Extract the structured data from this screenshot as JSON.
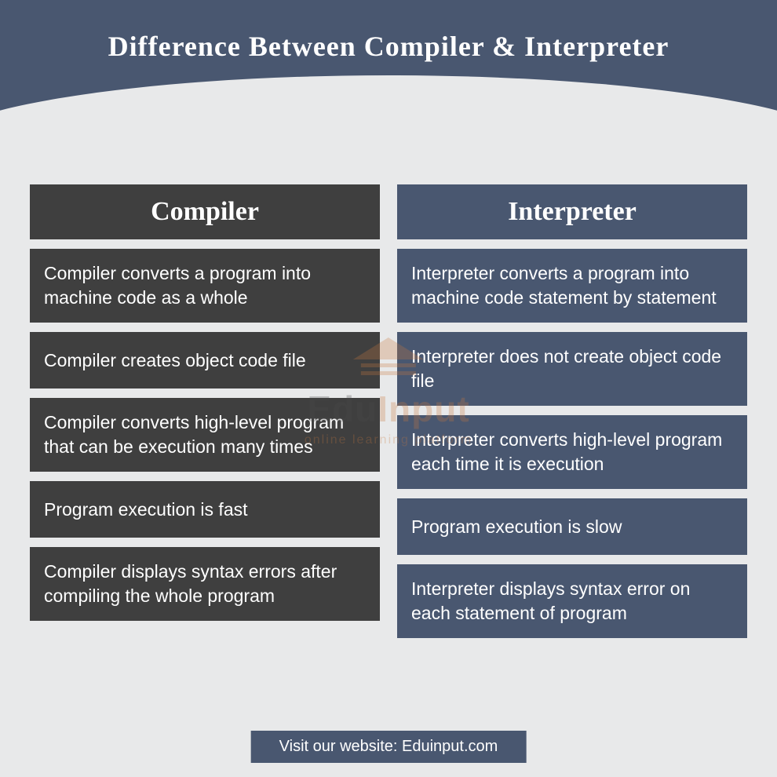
{
  "title": "Difference Between Compiler & Interpreter",
  "columns": {
    "left": {
      "header": "Compiler",
      "rows": [
        "Compiler converts a program into machine code as a whole",
        "Compiler creates object code file",
        "Compiler converts high-level program that can be execution many times",
        "Program execution is fast",
        "Compiler displays syntax errors after compiling the whole program"
      ]
    },
    "right": {
      "header": "Interpreter",
      "rows": [
        "Interpreter converts a program into machine code statement by statement",
        "Interpreter does not create object code file",
        "Interpreter converts high-level program each time it is execution",
        "Program execution is slow",
        "Interpreter displays syntax error on each statement of program"
      ]
    }
  },
  "footer": "Visit our website: Eduinput.com",
  "watermark": {
    "brand_prefix": "Edu",
    "brand_suffix": "Input",
    "tagline": "online learning platform"
  },
  "chart_data": {
    "type": "table",
    "title": "Difference Between Compiler & Interpreter",
    "columns": [
      "Compiler",
      "Interpreter"
    ],
    "rows": [
      [
        "Compiler converts a program into machine code as a whole",
        "Interpreter converts a program into machine code statement by statement"
      ],
      [
        "Compiler creates object code file",
        "Interpreter does not create object code file"
      ],
      [
        "Compiler converts high-level program that can be execution many times",
        "Interpreter converts high-level program each time it is execution"
      ],
      [
        "Program execution is fast",
        "Program execution is slow"
      ],
      [
        "Compiler displays syntax errors after compiling the whole program",
        "Interpreter displays syntax error on each statement of program"
      ]
    ]
  }
}
